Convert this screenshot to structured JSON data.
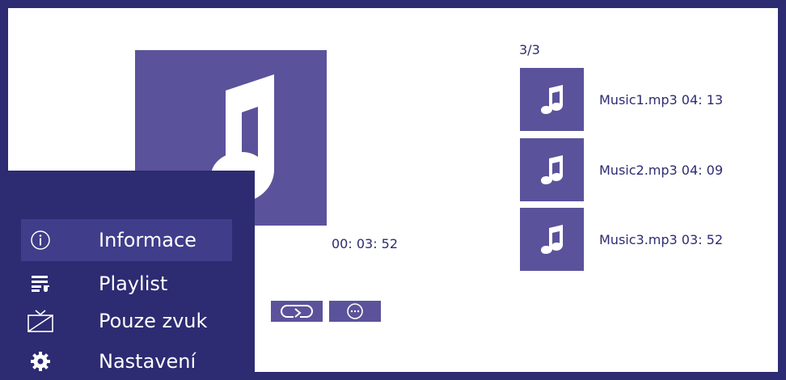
{
  "player": {
    "elapsed": "00: 03: 52"
  },
  "playlist": {
    "count": "3/3",
    "tracks": [
      {
        "label": "Music1.mp3 04: 13"
      },
      {
        "label": "Music2.mp3 04: 09"
      },
      {
        "label": "Music3.mp3 03: 52"
      }
    ]
  },
  "menu": {
    "items": [
      {
        "label": "Informace",
        "icon": "info-icon",
        "active": true
      },
      {
        "label": "Playlist",
        "icon": "playlist-icon"
      },
      {
        "label": "Pouze zvuk",
        "icon": "tv-off-icon"
      },
      {
        "label": "Nastavení",
        "icon": "gear-icon"
      }
    ]
  },
  "controls": {
    "repeat_icon": "repeat-icon",
    "more_icon": "more-icon"
  },
  "colors": {
    "frame": "#2d2b72",
    "accent": "#5a539b",
    "menu_highlight": "#403d8a",
    "background": "#ffffff"
  }
}
